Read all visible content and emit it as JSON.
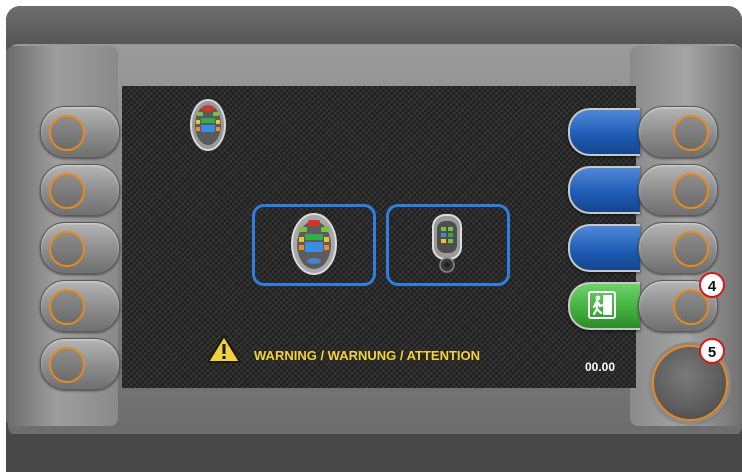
{
  "screen": {
    "warning_text": "WARNING / WARNUNG / ATTENTION",
    "timer_value": "00.00"
  },
  "soft_keys": [
    {
      "color": "#1d5ab2",
      "icon": "blank"
    },
    {
      "color": "#1d5ab2",
      "icon": "blank"
    },
    {
      "color": "#1d5ab2",
      "icon": "blank"
    },
    {
      "color": "#3fae3c",
      "icon": "emergency-exit-icon"
    }
  ],
  "options": [
    {
      "icon": "oval-handset-icon"
    },
    {
      "icon": "joystick-control-icon"
    }
  ],
  "callouts": {
    "four": "4",
    "five": "5"
  },
  "colors": {
    "accent_orange": "#e8891c",
    "selection_blue": "#2f7fe0",
    "warning_yellow": "#f2d23a"
  }
}
